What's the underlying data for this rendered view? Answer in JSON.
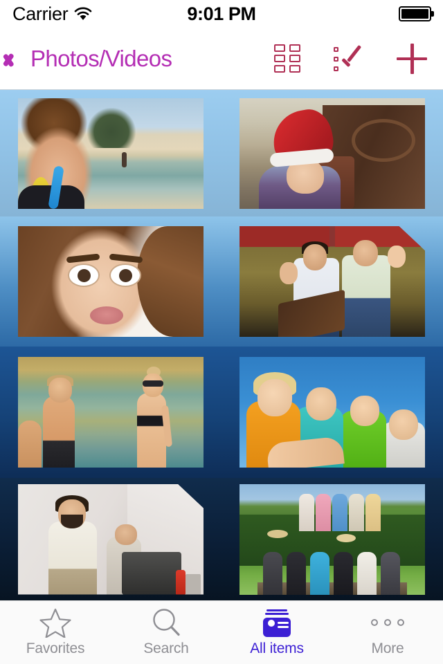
{
  "status_bar": {
    "carrier": "Carrier",
    "wifi_icon": "wifi-icon",
    "time": "9:01 PM",
    "battery_icon": "battery-full-icon"
  },
  "nav_bar": {
    "back_icon": "chevron-left-icon",
    "title": "Photos/Videos",
    "accent_color": "#b42eb4",
    "action_accent_color": "#b03055",
    "actions": [
      {
        "name": "grid-view-button",
        "icon": "grid-icon"
      },
      {
        "name": "select-items-button",
        "icon": "checklist-check-icon"
      },
      {
        "name": "add-button",
        "icon": "plus-icon"
      }
    ]
  },
  "gallery": {
    "rows": [
      {
        "row_index": 1,
        "background": "#8fc0e4",
        "cells": [
          {
            "name": "photo-thumbnail-beach-selfie",
            "caption": "Woman smiling on beach with blue straw",
            "type": "photo"
          },
          {
            "name": "photo-thumbnail-child-santa-hat",
            "caption": "Child in red Santa hat by wooden bench",
            "type": "photo"
          }
        ]
      },
      {
        "row_index": 2,
        "background": "#4e8ec4",
        "cells": [
          {
            "name": "photo-thumbnail-funny-face-selfie",
            "caption": "Selfie of woman making a funny face",
            "type": "photo"
          },
          {
            "name": "video-thumbnail-two-men-singing",
            "caption": "Two men singing on stage with music stand",
            "type": "video"
          }
        ]
      },
      {
        "row_index": 3,
        "background": "#154277",
        "cells": [
          {
            "name": "photo-thumbnail-ocean-couple",
            "caption": "Man and woman standing in ocean water",
            "type": "photo"
          },
          {
            "name": "photo-thumbnail-four-kids",
            "caption": "Four smiling children against blue sky",
            "type": "photo"
          }
        ]
      },
      {
        "row_index": 4,
        "background": "#0b1e36",
        "cells": [
          {
            "name": "video-thumbnail-office-men",
            "caption": "Two men in an office with a monitor",
            "type": "video"
          },
          {
            "name": "photo-thumbnail-group-field",
            "caption": "Group of people posing in a green field",
            "type": "photo"
          }
        ]
      }
    ]
  },
  "tab_bar": {
    "active_color": "#3c1fd4",
    "inactive_color": "#8e8e93",
    "tabs": [
      {
        "name": "tab-favorites",
        "label": "Favorites",
        "icon": "star-icon",
        "active": false
      },
      {
        "name": "tab-search",
        "label": "Search",
        "icon": "search-icon",
        "active": false
      },
      {
        "name": "tab-all-items",
        "label": "All items",
        "icon": "cards-stack-icon",
        "active": true
      },
      {
        "name": "tab-more",
        "label": "More",
        "icon": "ellipsis-icon",
        "active": false
      }
    ]
  }
}
